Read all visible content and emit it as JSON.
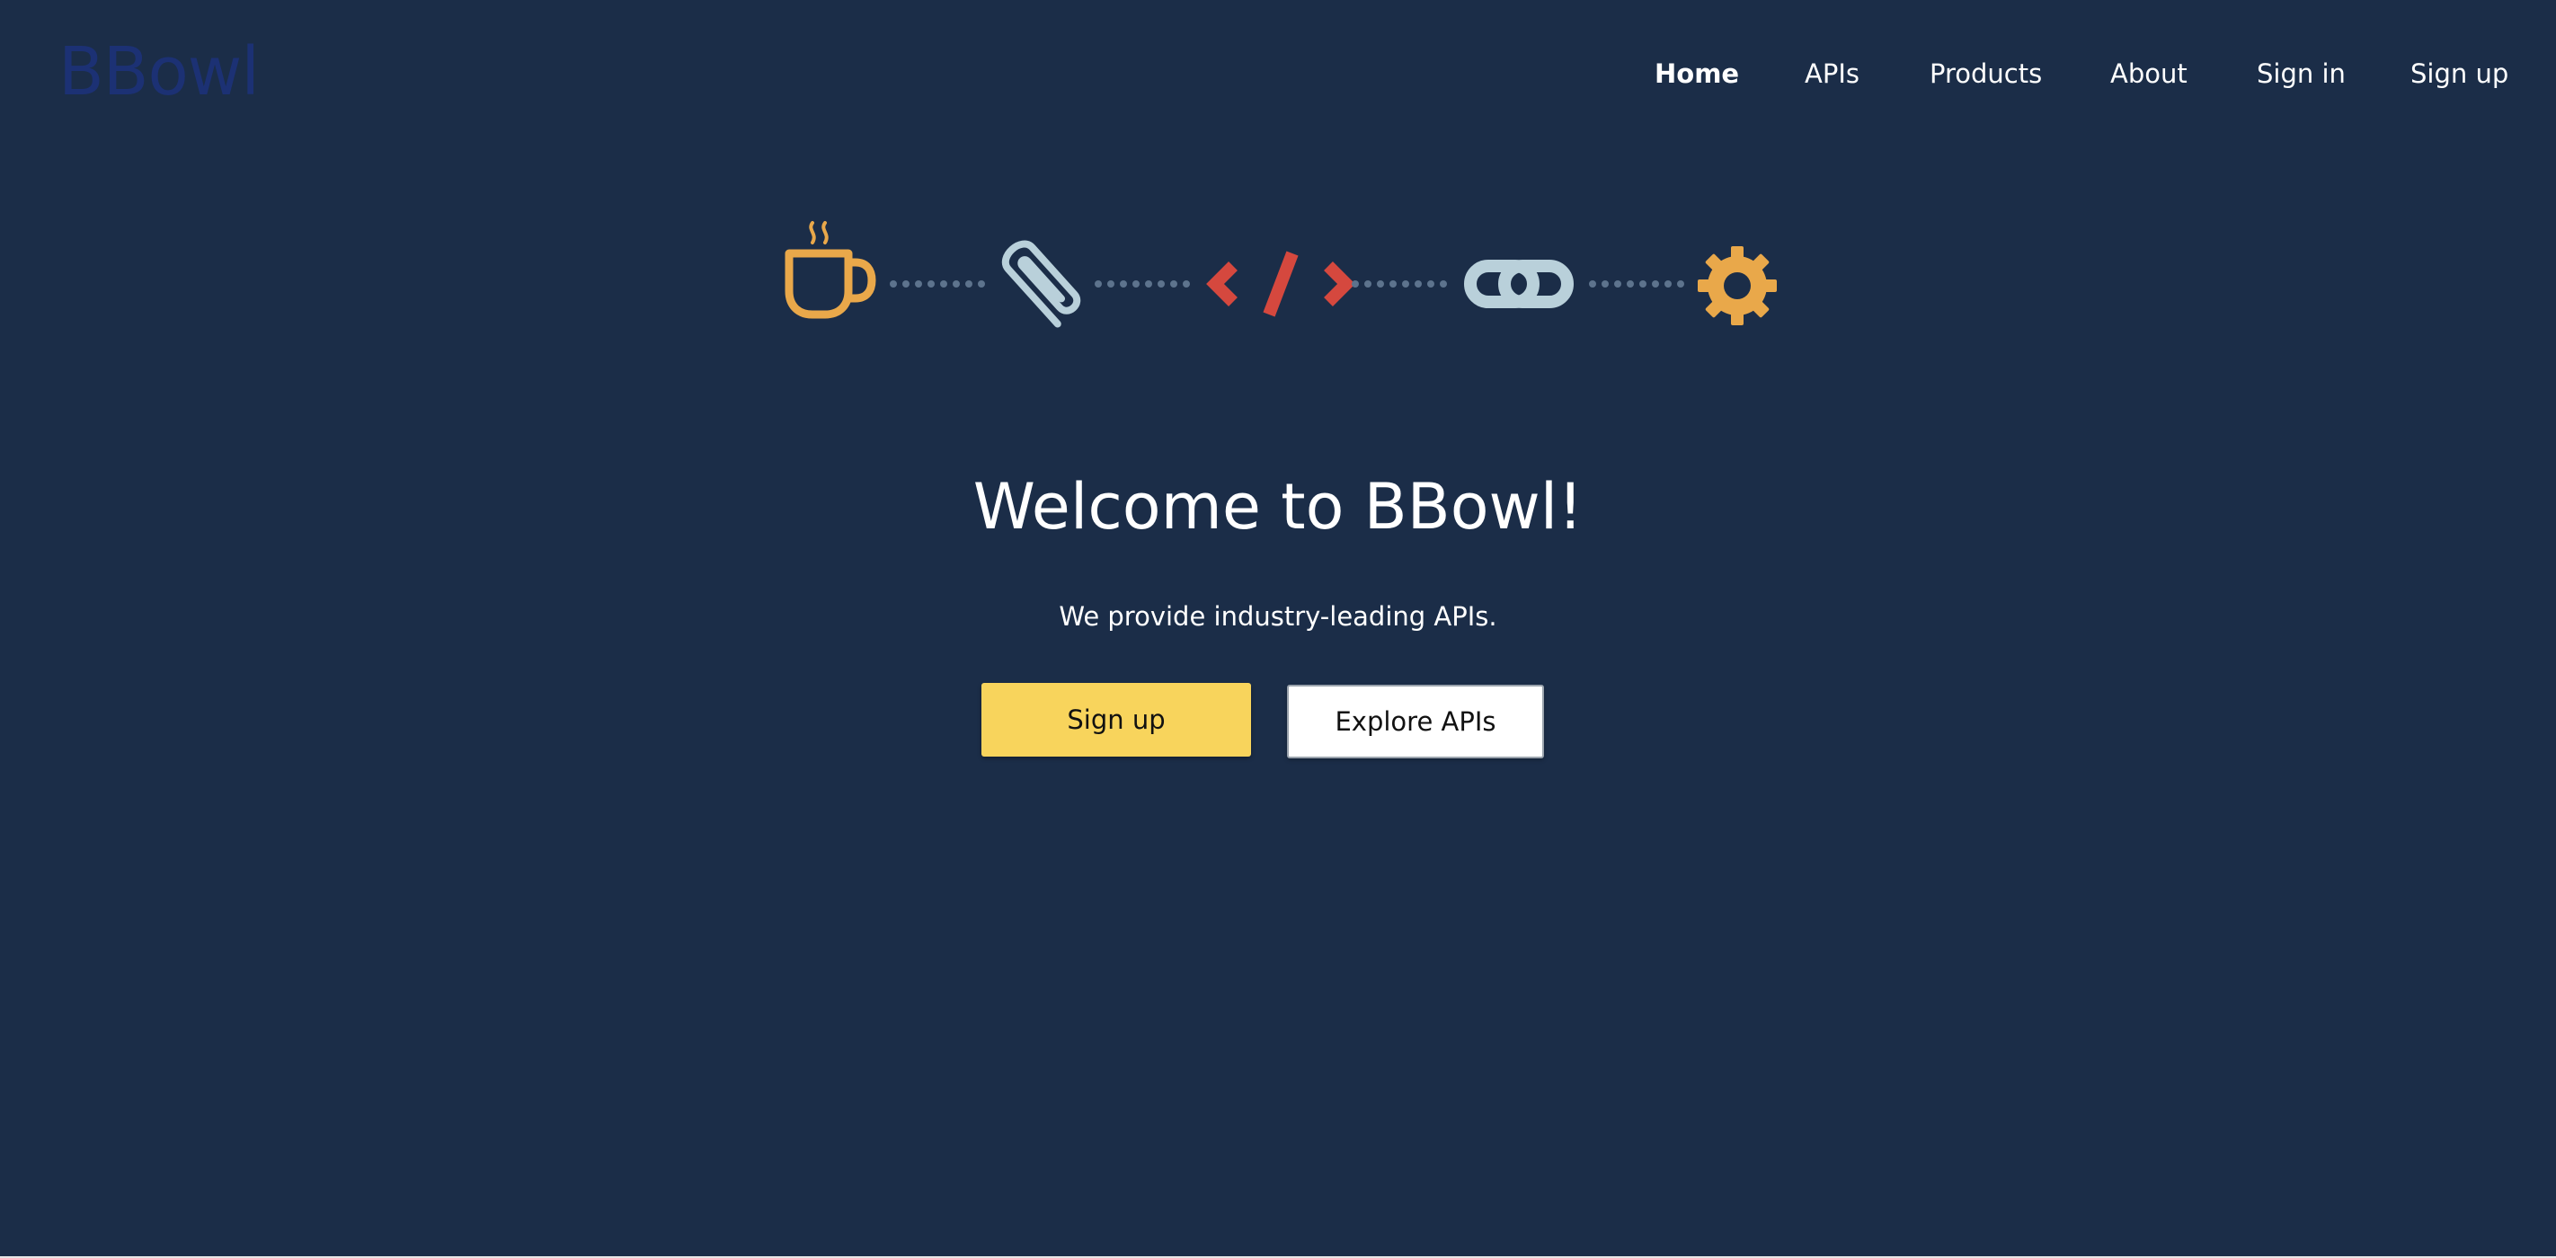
{
  "brand": {
    "logo_text": "BBowl"
  },
  "nav": {
    "items": [
      {
        "label": "Home",
        "active": true
      },
      {
        "label": "APIs",
        "active": false
      },
      {
        "label": "Products",
        "active": false
      },
      {
        "label": "About",
        "active": false
      },
      {
        "label": "Sign in",
        "active": false
      },
      {
        "label": "Sign up",
        "active": false
      }
    ]
  },
  "hero": {
    "icons": [
      "coffee-cup-icon",
      "paperclip-icon",
      "code-brackets-icon",
      "chain-link-icon",
      "gear-icon"
    ],
    "title": "Welcome to BBowl!",
    "subtitle": "We provide industry-leading APIs.",
    "primary_button": "Sign up",
    "secondary_button": "Explore APIs"
  },
  "colors": {
    "background": "#1b2d48",
    "accent_yellow": "#f8d45c",
    "icon_orange": "#e9a84a",
    "icon_red": "#d5483e",
    "icon_light": "#b9d0da",
    "dot_gray": "#5d738d"
  }
}
